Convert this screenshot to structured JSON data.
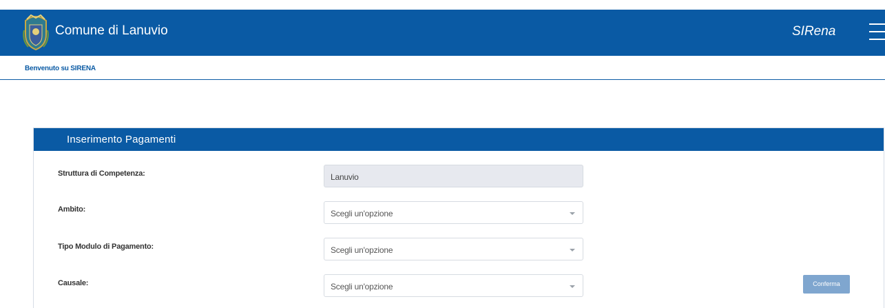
{
  "header": {
    "municipality": "Comune di Lanuvio",
    "brand": "SIRena",
    "crest_icon": "coat-of-arms-icon",
    "menu_icon": "hamburger-menu-icon",
    "background": "#0a5aa4"
  },
  "welcome": {
    "text": "Benvenuto su SIRENA"
  },
  "form": {
    "title": "Inserimento Pagamenti",
    "fields": [
      {
        "label": "Struttura di Competenza:",
        "value": "Lanuvio",
        "readonly": true
      },
      {
        "label": "Ambito:",
        "placeholder": "Scegli un'opzione"
      },
      {
        "label": "Tipo Modulo di Pagamento:",
        "placeholder": "Scegli un'opzione"
      },
      {
        "label": "Causale:",
        "placeholder": "Scegli un'opzione"
      }
    ],
    "confirm_label": "Conferma",
    "confirm_color": "#7fa6cf"
  }
}
